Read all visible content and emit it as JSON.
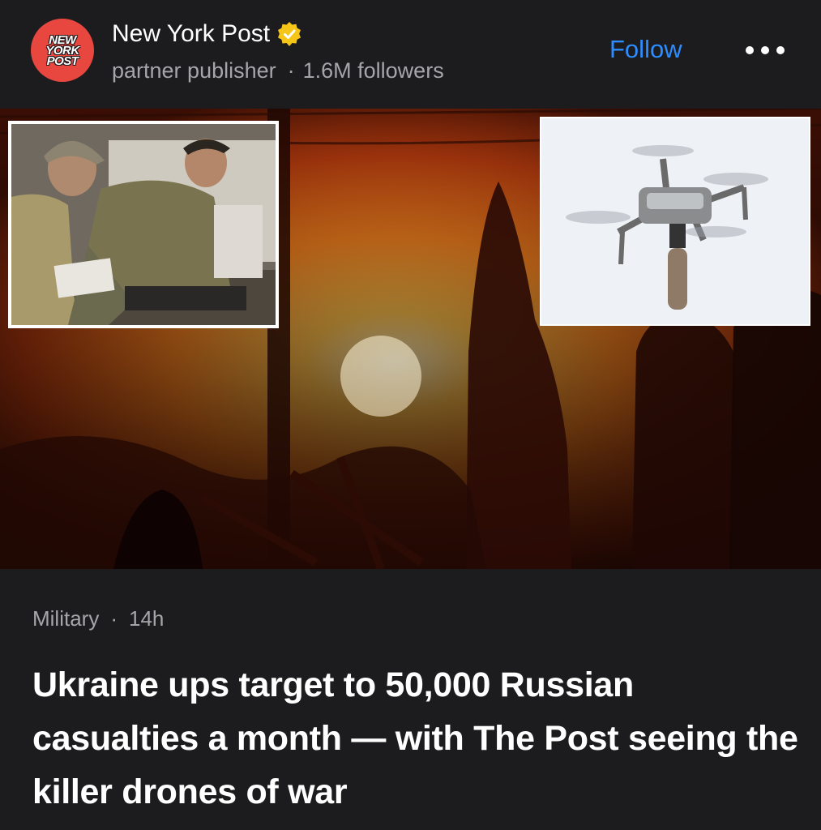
{
  "publisher": {
    "logo_lines": [
      "NEW",
      "YORK",
      "POST"
    ],
    "name": "New York Post",
    "verified_icon": "verified-badge-icon",
    "label": "partner publisher",
    "separator": "·",
    "followers": "1.6M followers"
  },
  "actions": {
    "follow_label": "Follow",
    "more_icon": "more-options-icon"
  },
  "article": {
    "category": "Military",
    "separator": "·",
    "age": "14h",
    "headline": "Ukraine ups target to 50,000 Russian casualties a month — with The Post seeing the killer drones of war"
  },
  "colors": {
    "background": "#1c1c1e",
    "accent": "#2d8cff",
    "logo": "#e8473f",
    "verified": "#f5c518",
    "secondary_text": "#a6a6aa"
  }
}
